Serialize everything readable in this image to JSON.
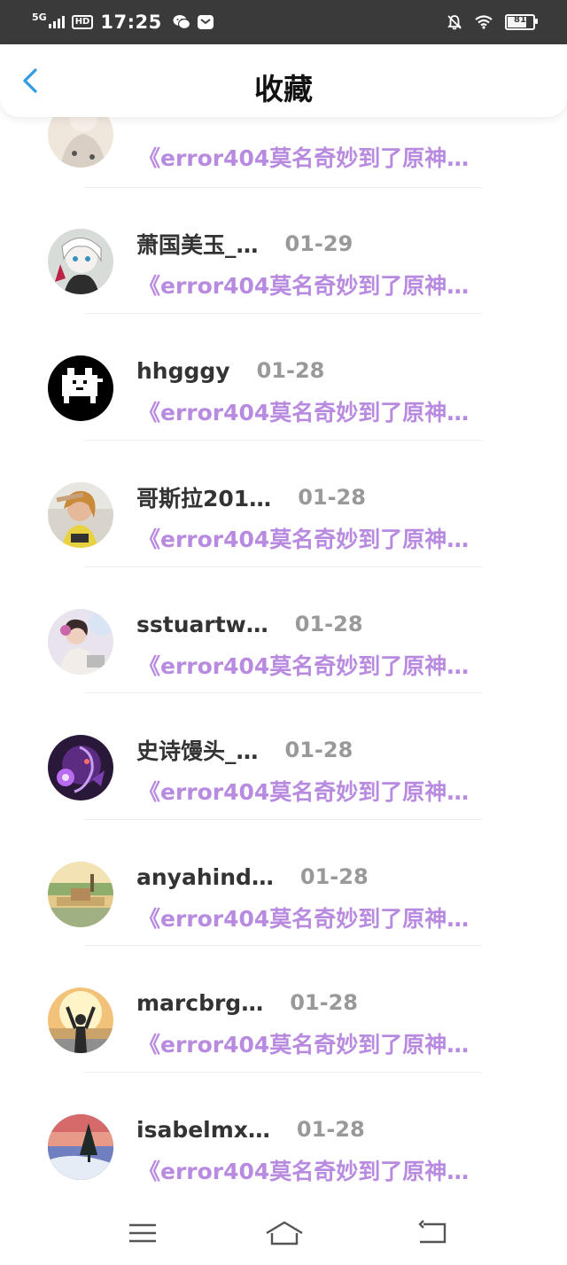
{
  "status_bar": {
    "network": "5G",
    "hd": "HD",
    "time": "17:25",
    "battery": "81",
    "icons": [
      "signal-icon",
      "wechat-icon",
      "message-app-icon",
      "bell-off-icon",
      "wifi-icon",
      "battery-icon"
    ],
    "battery_level": 0.81
  },
  "header": {
    "title": "收藏",
    "back_icon": "back-arrow-icon"
  },
  "colors": {
    "accent_link": "#b88ae0",
    "back_arrow": "#2f9be5",
    "status_bar_bg": "#3a3a3a"
  },
  "favorites": [
    {
      "name": "",
      "date": "",
      "subtitle": "《error404莫名奇妙到了原神…"
    },
    {
      "name": "萧国美玉_…",
      "date": "01-29",
      "subtitle": "《error404莫名奇妙到了原神…"
    },
    {
      "name": "hhgggy",
      "date": "01-28",
      "subtitle": "《error404莫名奇妙到了原神…"
    },
    {
      "name": "哥斯拉201…",
      "date": "01-28",
      "subtitle": "《error404莫名奇妙到了原神…"
    },
    {
      "name": "sstuartw…",
      "date": "01-28",
      "subtitle": "《error404莫名奇妙到了原神…"
    },
    {
      "name": "史诗馒头_…",
      "date": "01-28",
      "subtitle": "《error404莫名奇妙到了原神…"
    },
    {
      "name": "anyahind…",
      "date": "01-28",
      "subtitle": "《error404莫名奇妙到了原神…"
    },
    {
      "name": "marcbrg…",
      "date": "01-28",
      "subtitle": "《error404莫名奇妙到了原神…"
    },
    {
      "name": "isabelmx…",
      "date": "01-28",
      "subtitle": "《error404莫名奇妙到了原神…"
    }
  ],
  "nav_bar": {
    "icons": [
      "menu-icon",
      "home-icon",
      "back-icon"
    ]
  }
}
